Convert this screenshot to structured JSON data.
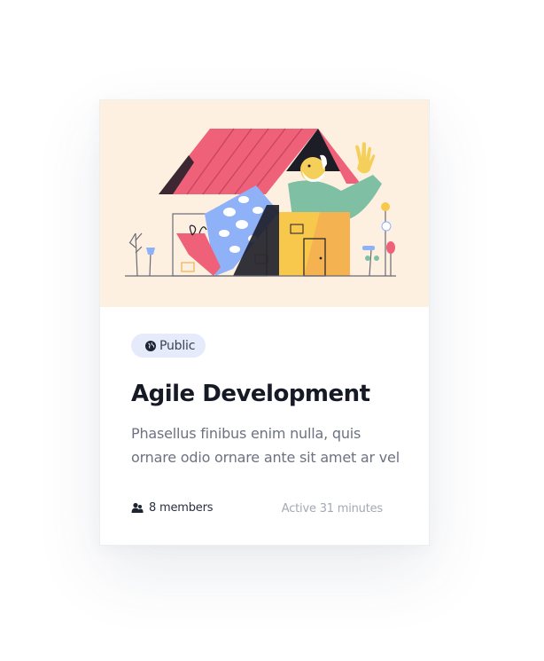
{
  "card": {
    "illustration": "house-with-person-illustration",
    "badge": {
      "icon": "globe-icon",
      "label": "Public"
    },
    "title": "Agile Development",
    "description": "Phasellus finibus enim nulla, quis ornare odio ornare ante sit amet ar vel",
    "members": {
      "icon": "users-icon",
      "label": "8 members"
    },
    "activity": "Active 31 minutes"
  },
  "colors": {
    "hero_background": "#fdf0e1",
    "badge_background": "#e5ebfb",
    "title": "#161a25",
    "muted_text": "#a3a8b3"
  }
}
